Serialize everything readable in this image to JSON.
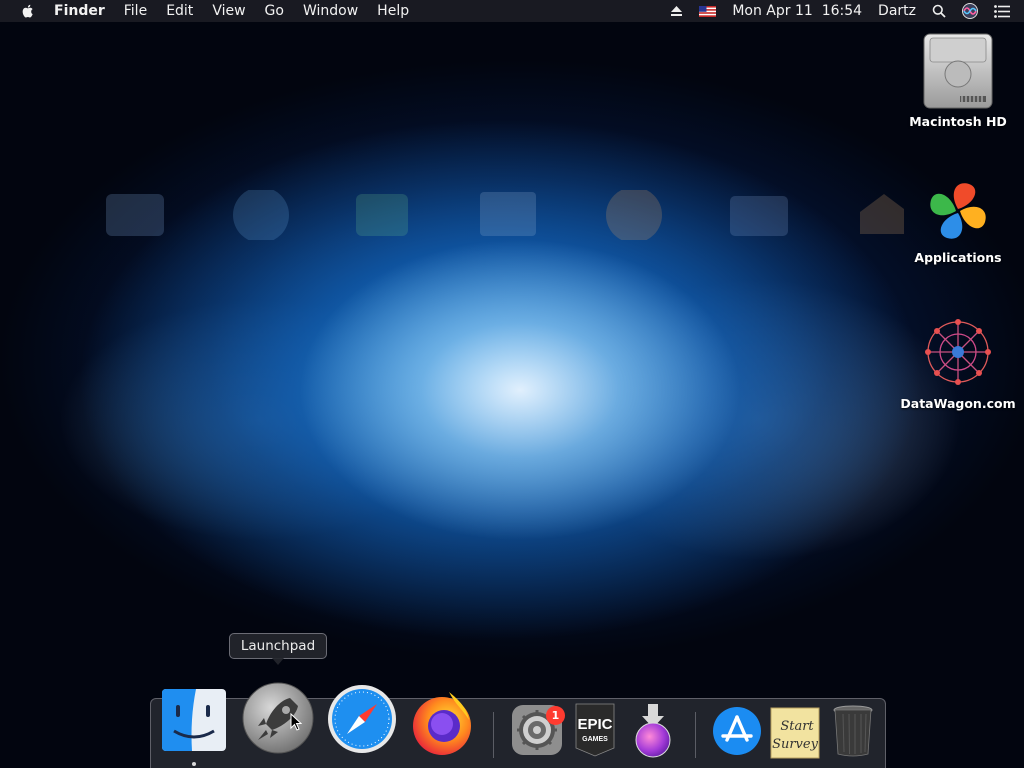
{
  "menubar": {
    "app_name": "Finder",
    "menus": [
      "File",
      "Edit",
      "View",
      "Go",
      "Window",
      "Help"
    ],
    "status": {
      "datetime": "Mon Apr 11  16:54",
      "user": "Dartz"
    },
    "icons": [
      "apple-icon",
      "eject-icon",
      "us-flag-icon",
      "search-icon",
      "siri-icon",
      "notification-center-icon"
    ]
  },
  "desktop": {
    "icons": [
      {
        "label": "Macintosh HD",
        "icon": "hard-drive-icon"
      },
      {
        "label": "Applications",
        "icon": "applications-icon"
      },
      {
        "label": "DataWagon.com",
        "icon": "datawagon-icon"
      }
    ]
  },
  "tooltip": {
    "text": "Launchpad"
  },
  "dock": {
    "apps": [
      {
        "name": "finder",
        "icon": "finder-icon",
        "running": true
      },
      {
        "name": "launchpad",
        "icon": "launchpad-rocket-icon",
        "running": false
      },
      {
        "name": "safari",
        "icon": "safari-compass-icon",
        "running": false
      },
      {
        "name": "firefox",
        "icon": "firefox-icon",
        "running": false
      },
      {
        "name": "system-preferences",
        "icon": "gear-icon",
        "badge": "1"
      },
      {
        "name": "epic-games",
        "icon": "epic-games-icon",
        "logo_text_top": "EPIC",
        "logo_text_bottom": "GAMES"
      },
      {
        "name": "installer",
        "icon": "installer-icon"
      },
      {
        "name": "app-store",
        "icon": "app-store-icon"
      },
      {
        "name": "start-survey",
        "icon": "sticky-note-icon",
        "note_line1": "Start",
        "note_line2": "Survey"
      },
      {
        "name": "trash",
        "icon": "trash-icon"
      }
    ]
  }
}
